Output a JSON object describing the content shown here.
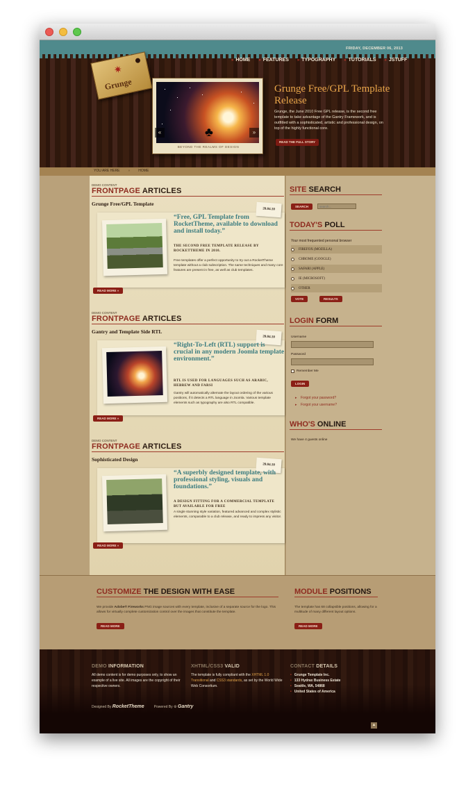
{
  "header": {
    "date": "FRIDAY, DECEMBER 06, 2013",
    "logo_text": "Grunge",
    "nav": [
      "HOME",
      "FEATURES",
      "TYPOGRAPHY",
      "TUTORIALS",
      "JSTUFF"
    ],
    "feature": {
      "title": "Grunge Free/GPL Template Release",
      "text": "Grunge, the June 2010 Free GPL release, is the second free template to take advantage of the Gantry Framework, and is outfitted with a sophisticated, artistic and professional design, on top of the highly functional core.",
      "button": "READ THE FULL STORY",
      "slide_caption": "BEYOND THE REALMS OF DESIGN"
    }
  },
  "breadcrumb": {
    "label": "YOU ARE HERE",
    "current": "HOME"
  },
  "articles": [
    {
      "label": "DEMO CONTENT",
      "heading_hl": "FRONTPAGE",
      "heading": "ARTICLES",
      "title": "Grunge Free/GPL Template",
      "date": "20.04.10",
      "quote": "“Free, GPL Template from RocketTheme, available to download and install today.”",
      "sub": "THE SECOND FREE TEMPLATE RELEASE BY ROCKETTHEME IN 2010.",
      "body": "Free templates offer a perfect opportunity to try out a RocketTheme template without a club subscription. The same techniques and many core features are present in free, as well as club templates.",
      "button": "READ MORE »"
    },
    {
      "label": "DEMO CONTENT",
      "heading_hl": "FRONTPAGE",
      "heading": "ARTICLES",
      "title": "Gantry and Template Side RTL",
      "date": "20.04.10",
      "quote": "“Right-To-Left (RTL) support is crucial in any modern Joomla template environment.”",
      "sub": "RTL IS USED FOR LANGUAGES SUCH AS ARABIC, HEBREW AND FARSI",
      "body": "Gantry will automatically alternate the layout ordering of the various positions, if it detects a RTL language in Joomla. Various template elements such as typography are also RTL compatible.",
      "button": "READ MORE »"
    },
    {
      "label": "DEMO CONTENT",
      "heading_hl": "FRONTPAGE",
      "heading": "ARTICLES",
      "title": "Sophisticated Design",
      "date": "20.04.10",
      "quote": "“A superbly designed template, with professional styling, visuals and foundations.”",
      "sub": "A DESIGN FITTING FOR A COMMERCIAL TEMPLATE BUT AVAILABLE FOR FREE",
      "body": "A single stunning style variation, featured advanced and complex stylistic elements, comparable to a club release, and ready to impress any visitor.",
      "button": "READ MORE »"
    }
  ],
  "sidebar": {
    "search": {
      "title_hl": "SITE",
      "title": "SEARCH",
      "button": "SEARCH",
      "placeholder": "search..."
    },
    "poll": {
      "title_hl": "TODAY'S",
      "title": "POLL",
      "question": "Your most frequented personal browser",
      "options": [
        "FIREFOX (MOZILLA)",
        "CHROME (GOOGLE)",
        "SAFARI (APPLE)",
        "IE (MICROSOFT)",
        "OTHER"
      ],
      "vote": "VOTE",
      "results": "RESULTS"
    },
    "login": {
      "title_hl": "LOGIN",
      "title": "FORM",
      "username_label": "Username",
      "password_label": "Password",
      "remember": "Remember Me",
      "button": "LOGIN",
      "forgot_password": "Forgot your password?",
      "forgot_username": "Forgot your username?"
    },
    "online": {
      "title_hl": "WHO'S",
      "title": "ONLINE",
      "text": "We have 4 guests online"
    }
  },
  "bottom": {
    "customize": {
      "title_hl": "CUSTOMIZE",
      "title": "THE DESIGN WITH EASE",
      "text_a": "We provide ",
      "text_b": "Adobe® Fireworks",
      "text_c": " PNG image sources with every template, inclusive of a separate source for the logo. This allows for virtually complete customization control over the images that constitute the template.",
      "button": "READ MORE"
    },
    "module": {
      "title_hl": "MODULE",
      "title": "POSITIONS",
      "text": "The template has 68 collapsible positions, allowing for a multitude of many different layout options.",
      "button": "READ MORE"
    }
  },
  "footer": {
    "demo": {
      "title_dim": "DEMO",
      "title": "INFORMATION",
      "text": "All demo content is for demo purposes only, to show an example of a live site. All images are the copyright of their respective owners."
    },
    "valid": {
      "title_dim": "XHTML/CSS3",
      "title": "VALID",
      "text_a": "The template is fully compliant with the ",
      "text_b": "XHTML 1.0 Transitional",
      "text_c": " and ",
      "text_d": "CSS3 standards",
      "text_e": ", as set by the World Wide Web Consortium."
    },
    "contact": {
      "title_dim": "CONTACT",
      "title": "DETAILS",
      "lines": [
        "Grunge Template Inc.",
        "133 Hydrax Business Estate",
        "Seattle, WA, 54868",
        "United States of America"
      ]
    },
    "designed_by": "Designed By",
    "designer": "RocketTheme",
    "powered_by": "Powered By",
    "powered": "Gantry"
  },
  "colors": {
    "accent": "#8e2b1f",
    "teal": "#3d7d80",
    "gold": "#e9a64a"
  }
}
